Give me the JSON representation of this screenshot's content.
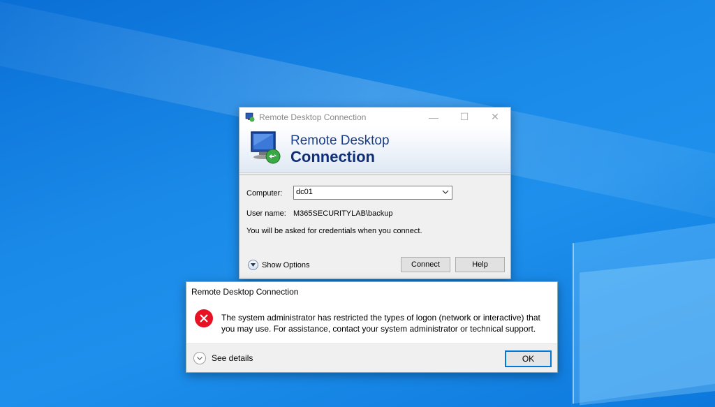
{
  "rdc_window": {
    "title": "Remote Desktop Connection",
    "banner_line1": "Remote Desktop",
    "banner_line2": "Connection",
    "computer_label": "Computer:",
    "computer_value": "dc01",
    "username_label": "User name:",
    "username_value": "M365SECURITYLAB\\backup",
    "info_text": "You will be asked for credentials when you connect.",
    "show_options_label": "Show Options",
    "connect_label": "Connect",
    "help_label": "Help",
    "title_buttons": {
      "minimize": "—",
      "maximize": "☐",
      "close": "✕"
    }
  },
  "error_dialog": {
    "title": "Remote Desktop Connection",
    "message": "The system administrator has restricted the types of logon (network or interactive) that you may use. For assistance, contact your system administrator or technical support.",
    "see_details_label": "See details",
    "ok_label": "OK",
    "icon": "error-icon",
    "icon_color": "#e81123"
  },
  "colors": {
    "desktop": "#1a8ae8",
    "accent": "#0078d7",
    "banner_text": "#0e2f78"
  }
}
